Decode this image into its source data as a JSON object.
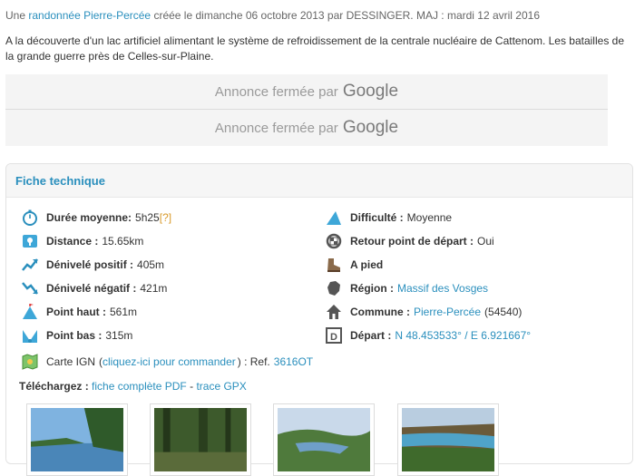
{
  "meta": {
    "prefix": "Une",
    "randonnee_link": "randonnée Pierre-Percée",
    "suffix": "créée le dimanche 06 octobre 2013 par DESSINGER. MAJ : mardi 12 avril 2016"
  },
  "description": "A la découverte d'un lac artificiel alimentant le système de refroidissement de la centrale nucléaire de Cattenom. Les batailles de la grande guerre près de Celles-sur-Plaine.",
  "ads": [
    {
      "text": "Annonce fermée par",
      "brand": "Google"
    },
    {
      "text": "Annonce fermée par",
      "brand": "Google"
    }
  ],
  "fiche": {
    "title": "Fiche technique",
    "duree": {
      "label": "Durée moyenne:",
      "value": "5h25",
      "help": "[?]"
    },
    "distance": {
      "label": "Distance :",
      "value": "15.65km"
    },
    "deniv_pos": {
      "label": "Dénivelé positif :",
      "value": "405m"
    },
    "deniv_neg": {
      "label": "Dénivelé négatif :",
      "value": "421m"
    },
    "point_haut": {
      "label": "Point haut :",
      "value": "561m"
    },
    "point_bas": {
      "label": "Point bas :",
      "value": "315m"
    },
    "difficulte": {
      "label": "Difficulté :",
      "value": "Moyenne"
    },
    "retour": {
      "label": "Retour point de départ :",
      "value": "Oui"
    },
    "mode": {
      "label": "A pied"
    },
    "region": {
      "label": "Région :",
      "value": "Massif des Vosges"
    },
    "commune": {
      "label": "Commune :",
      "value": "Pierre-Percée",
      "extra": "(54540)"
    },
    "depart": {
      "label": "Départ :",
      "value": "N 48.453533° / E 6.921667°"
    },
    "carte": {
      "label": "Carte IGN",
      "open": "(",
      "link": "cliquez-ici pour commander",
      "close": ") : Ref.",
      "ref": "3616OT"
    }
  },
  "telechargez": {
    "label": "Téléchargez :",
    "pdf": "fiche complète PDF",
    "sep": "-",
    "gpx": "trace GPX"
  },
  "icons": {
    "duree": "stopwatch-icon",
    "distance": "map-pin-icon",
    "deniv_pos": "ascent-chart-icon",
    "deniv_neg": "descent-chart-icon",
    "point_haut": "summit-icon",
    "point_bas": "valley-icon",
    "difficulte": "mountain-icon",
    "retour": "loop-icon",
    "mode": "hiking-boot-icon",
    "region": "region-map-icon",
    "commune": "house-icon",
    "depart": "start-flag-icon",
    "carte": "ign-map-icon"
  },
  "colors": {
    "link": "#2a8fbd",
    "accent": "#2a8fbd"
  }
}
